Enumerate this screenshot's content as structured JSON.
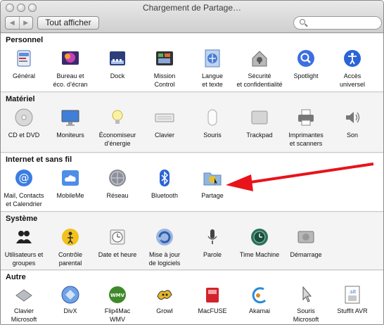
{
  "window": {
    "title": "Chargement de Partage…",
    "show_all_label": "Tout afficher",
    "back_glyph": "◀",
    "forward_glyph": "▶"
  },
  "sections": [
    {
      "title": "Personnel",
      "items": [
        {
          "label": "Général",
          "icon": "general-icon"
        },
        {
          "label": "Bureau et\néco. d’écran",
          "icon": "desktop-screensaver-icon"
        },
        {
          "label": "Dock",
          "icon": "dock-icon"
        },
        {
          "label": "Mission\nControl",
          "icon": "mission-control-icon"
        },
        {
          "label": "Langue\net texte",
          "icon": "language-text-icon"
        },
        {
          "label": "Sécurité\net confidentialité",
          "icon": "security-house-icon"
        },
        {
          "label": "Spotlight",
          "icon": "spotlight-icon"
        },
        {
          "label": "Accès\nuniversel",
          "icon": "universal-access-icon"
        }
      ]
    },
    {
      "title": "Matériel",
      "items": [
        {
          "label": "CD et DVD",
          "icon": "cd-dvd-icon"
        },
        {
          "label": "Moniteurs",
          "icon": "displays-icon"
        },
        {
          "label": "Économiseur\nd’énergie",
          "icon": "energy-saver-bulb-icon"
        },
        {
          "label": "Clavier",
          "icon": "keyboard-icon"
        },
        {
          "label": "Souris",
          "icon": "mouse-icon"
        },
        {
          "label": "Trackpad",
          "icon": "trackpad-icon"
        },
        {
          "label": "Imprimantes\net scanners",
          "icon": "printer-icon"
        },
        {
          "label": "Son",
          "icon": "speaker-icon"
        }
      ]
    },
    {
      "title": "Internet et sans fil",
      "items": [
        {
          "label": "Mail, Contacts\net Calendrier",
          "icon": "mail-at-icon"
        },
        {
          "label": "MobileMe",
          "icon": "mobileme-cloud-icon"
        },
        {
          "label": "Réseau",
          "icon": "network-globe-icon"
        },
        {
          "label": "Bluetooth",
          "icon": "bluetooth-icon"
        },
        {
          "label": "Partage",
          "icon": "sharing-folder-icon"
        }
      ]
    },
    {
      "title": "Système",
      "items": [
        {
          "label": "Utilisateurs et\ngroupes",
          "icon": "users-groups-icon"
        },
        {
          "label": "Contrôle\nparental",
          "icon": "parental-controls-icon"
        },
        {
          "label": "Date et heure",
          "icon": "date-time-clock-icon"
        },
        {
          "label": "Mise à jour\nde logiciels",
          "icon": "software-update-icon"
        },
        {
          "label": "Parole",
          "icon": "microphone-icon"
        },
        {
          "label": "Time Machine",
          "icon": "time-machine-icon"
        },
        {
          "label": "Démarrage",
          "icon": "startup-disk-icon"
        }
      ]
    },
    {
      "title": "Autre",
      "items": [
        {
          "label": "Clavier\nMicrosoft",
          "icon": "microsoft-keyboard-icon"
        },
        {
          "label": "DivX",
          "icon": "divx-icon"
        },
        {
          "label": "Flip4Mac\nWMV",
          "icon": "flip4mac-wmv-icon"
        },
        {
          "label": "Growl",
          "icon": "growl-icon"
        },
        {
          "label": "MacFUSE",
          "icon": "macfuse-icon"
        },
        {
          "label": "Akamai",
          "icon": "akamai-icon"
        },
        {
          "label": "Souris\nMicrosoft",
          "icon": "microsoft-mouse-icon"
        },
        {
          "label": "StuffIt AVR",
          "icon": "stuffit-icon"
        }
      ]
    }
  ],
  "icon_text": {
    "wmv": "WMV",
    "sit": ".sit"
  },
  "colors": {
    "arrow": "#e8131b",
    "accent_blue": "#2a64d6"
  }
}
